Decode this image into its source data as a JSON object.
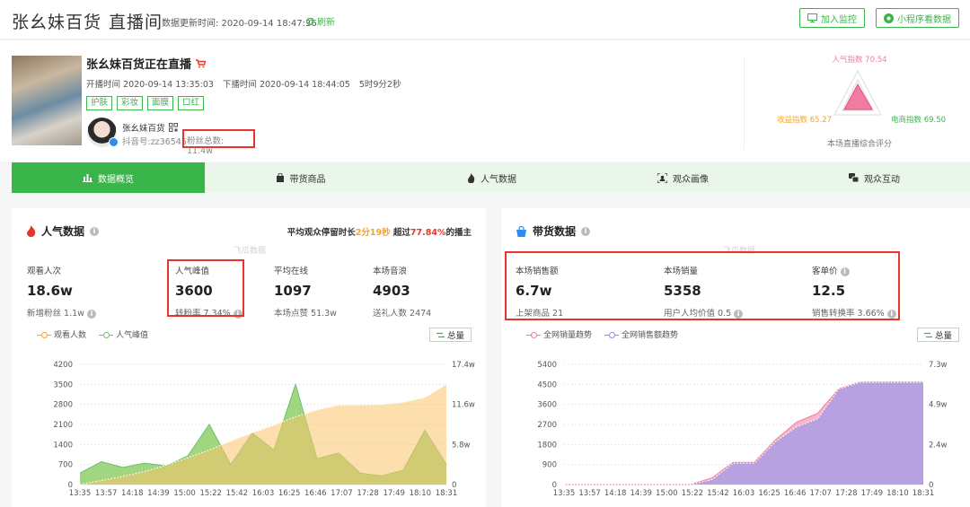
{
  "header": {
    "title": "张幺妹百货",
    "subtitle": "直播间",
    "update_label": "数据更新时间: 2020-09-14 18:47:36",
    "refresh": "刷新",
    "btn_monitor": "加入监控",
    "btn_miniapp": "小程序看数据"
  },
  "live": {
    "title": "张幺妹百货正在直播",
    "start": "开播时间 2020-09-14 13:35:03",
    "end": "下播时间 2020-09-14 18:44:05",
    "duration": "5时9分2秒",
    "tags": [
      "护肤",
      "彩妆",
      "面膜",
      "口红"
    ],
    "anchor_name": "张幺妹百货",
    "anchor_id": "抖音号:zz36545",
    "fans": "粉丝总数: 11.4w"
  },
  "radar": {
    "popularity": "人气指数 70.54",
    "income": "收益指数 65.27",
    "ecommerce": "电商指数 69.50",
    "caption": "本场直播综合评分"
  },
  "tabs": [
    "数据概览",
    "带货商品",
    "人气数据",
    "观众画像",
    "观众互动"
  ],
  "popularity": {
    "title": "人气数据",
    "stay_pre": "平均观众停留时长",
    "stay_val": "2分19秒",
    "stay_mid": " 超过",
    "stay_pct": "77.84%",
    "stay_post": "的播主",
    "watermark": "飞瓜数据",
    "metrics": [
      {
        "label": "观看人次",
        "value": "18.6w",
        "sub": "新增粉丝 1.1w"
      },
      {
        "label": "人气峰值",
        "value": "3600",
        "sub": "转粉率 7.34%"
      },
      {
        "label": "平均在线",
        "value": "1097",
        "sub": "本场点赞 51.3w"
      },
      {
        "label": "本场音浪",
        "value": "4903",
        "sub": "送礼人数 2474"
      }
    ],
    "legend": [
      "观看人数",
      "人气峰值"
    ],
    "total": "总量"
  },
  "sales": {
    "title": "带货数据",
    "watermark": "飞瓜数据",
    "metrics": [
      {
        "label": "本场销售额",
        "value": "6.7w",
        "sub": "上架商品 21"
      },
      {
        "label": "本场销量",
        "value": "5358",
        "sub": "用户人均价值 0.5"
      },
      {
        "label": "客单价",
        "value": "12.5",
        "sub": "销售转换率 3.66%"
      }
    ],
    "legend": [
      "全网销量趋势",
      "全网销售额趋势"
    ],
    "total": "总量"
  },
  "colors": {
    "green": "#3ab54a",
    "red": "#e8342d",
    "orange": "#f5a623",
    "pink": "#f07ca0",
    "purple": "#8f8fe0"
  },
  "chart_data": [
    {
      "type": "line",
      "x": [
        "13:35",
        "13:57",
        "14:18",
        "14:39",
        "15:00",
        "15:22",
        "15:42",
        "16:03",
        "16:25",
        "16:46",
        "17:07",
        "17:28",
        "17:49",
        "18:10",
        "18:31"
      ],
      "series": [
        {
          "name": "人气峰值",
          "axis": "left",
          "values": [
            400,
            800,
            600,
            750,
            650,
            1000,
            2100,
            700,
            1800,
            1200,
            3500,
            900,
            1100,
            400,
            300,
            500,
            1900,
            700
          ]
        },
        {
          "name": "观看人数",
          "axis": "right",
          "values": [
            0,
            0.6,
            1.2,
            1.9,
            2.8,
            3.9,
            5.0,
            6.3,
            7.5,
            8.6,
            9.8,
            10.8,
            11.5,
            11.5,
            11.6,
            11.9,
            12.6,
            14.5
          ]
        }
      ],
      "y_left": {
        "ticks": [
          "0",
          "700",
          "1400",
          "2100",
          "2800",
          "3500",
          "4200"
        ],
        "range": [
          0,
          4200
        ]
      },
      "y_right": {
        "ticks": [
          "0",
          "5.8w",
          "11.6w",
          "17.4w"
        ],
        "range": [
          0,
          17.4
        ]
      }
    },
    {
      "type": "area",
      "x": [
        "13:35",
        "13:57",
        "14:18",
        "14:39",
        "15:00",
        "15:22",
        "15:42",
        "16:03",
        "16:25",
        "16:46",
        "17:07",
        "17:28",
        "17:49",
        "18:10",
        "18:31"
      ],
      "series": [
        {
          "name": "全网销量趋势",
          "axis": "left",
          "values": [
            0,
            0,
            0,
            0,
            0,
            0,
            0,
            300,
            1000,
            1000,
            2000,
            2800,
            3200,
            4300,
            4600,
            4600,
            4600,
            4600
          ]
        },
        {
          "name": "全网销售额趋势",
          "axis": "right",
          "values": [
            0,
            0,
            0,
            0,
            0,
            0,
            0,
            0.3,
            1.3,
            1.3,
            2.6,
            3.5,
            4.0,
            5.8,
            6.2,
            6.2,
            6.2,
            6.2
          ]
        }
      ],
      "y_left": {
        "ticks": [
          "0",
          "900",
          "1800",
          "2700",
          "3600",
          "4500",
          "5400"
        ],
        "range": [
          0,
          5400
        ]
      },
      "y_right": {
        "ticks": [
          "0",
          "2.4w",
          "4.9w",
          "7.3w"
        ],
        "range": [
          0,
          7.3
        ]
      }
    }
  ]
}
